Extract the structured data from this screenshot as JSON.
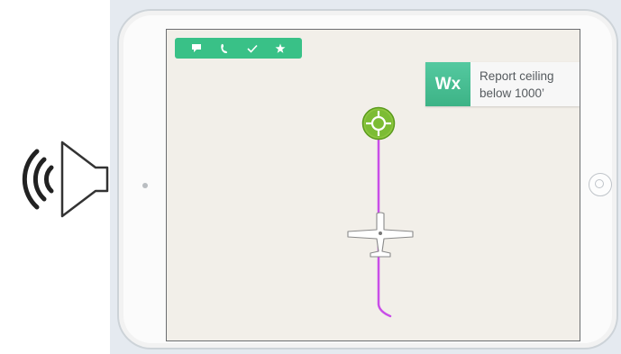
{
  "toolbar": {
    "items": [
      {
        "name": "chat",
        "icon": "speech-bubble-icon"
      },
      {
        "name": "phone",
        "icon": "phone-icon"
      },
      {
        "name": "confirm",
        "icon": "checkmark-icon"
      },
      {
        "name": "favorite",
        "icon": "star-icon"
      }
    ]
  },
  "wx_card": {
    "badge": "Wx",
    "line1": "Report ceiling",
    "line2": "below 1000’"
  },
  "icons": {
    "audio": "speaker-icon",
    "waypoint": "crosshair-icon",
    "aircraft": "airplane-icon"
  },
  "colors": {
    "toolbar": "#39c187",
    "route": "#c94ee8",
    "waypoint": "#7cbc34",
    "wx_badge": "#45bb8e",
    "map_background": "#f2efe9"
  }
}
